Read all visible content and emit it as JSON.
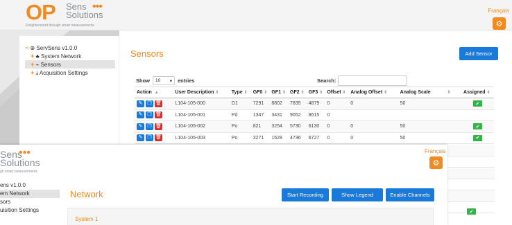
{
  "back": {
    "logo": {
      "op": "OP",
      "line1": "Sens",
      "line2": "Solutions",
      "dots": "•••",
      "tagline": "Enlightenment through smart measurements"
    },
    "language": "Français",
    "tree": {
      "root": "ServSens v1.0.0",
      "items": [
        "System Network",
        "Sensors",
        "Acquisition Settings"
      ],
      "selected_index": 1
    },
    "title": "Sensors",
    "add_button": "Add Sensor",
    "show_label": "Show",
    "show_value": "10",
    "entries_label": "entries",
    "search_label": "Search:",
    "table": {
      "headers": [
        "Action",
        "User Description",
        "Type",
        "GF0",
        "GF1",
        "GF2",
        "GF3",
        "Offset",
        "Analog Offset",
        "Analog Scale",
        "Assigned"
      ],
      "rows": [
        {
          "desc": "L104-105-000",
          "type": "D1",
          "gf0": "7291",
          "gf1": "8802",
          "gf2": "7835",
          "gf3": "4879",
          "offset": "0",
          "aoffset": "0",
          "ascale": "50",
          "assigned": true
        },
        {
          "desc": "L104-105-001",
          "type": "Pd",
          "gf0": "1347",
          "gf1": "3431",
          "gf2": "9052",
          "gf3": "8615",
          "offset": "0",
          "aoffset": "",
          "ascale": "",
          "assigned": false
        },
        {
          "desc": "L104-105-002",
          "type": "Po",
          "gf0": "821",
          "gf1": "3254",
          "gf2": "5730",
          "gf3": "6130",
          "offset": "0",
          "aoffset": "0",
          "ascale": "50",
          "assigned": true
        },
        {
          "desc": "L104-105-003",
          "type": "Po",
          "gf0": "3271",
          "gf1": "1528",
          "gf2": "4736",
          "gf3": "6727",
          "offset": "0",
          "aoffset": "0",
          "ascale": "50",
          "assigned": true
        }
      ]
    }
  },
  "front": {
    "logo": {
      "line1": "Sens",
      "line2": "Solutions",
      "dots": "•••",
      "tagline": "gh smart measurements"
    },
    "language": "Français",
    "tree": [
      "ens v1.0.0",
      "em Network",
      "sors",
      "uisition Settings"
    ],
    "selected_index": 1,
    "title": "Network",
    "buttons": {
      "start": "Start Recording",
      "legend": "Show Legend",
      "enable": "Enable Channels"
    },
    "system_title": "System 1"
  },
  "icons": {
    "gear": "⚙",
    "edit": "✎",
    "copy": "❐",
    "delete": "🗑",
    "check": "✔",
    "sort_both": "⇕",
    "sort_up": "▲",
    "caret": "▾"
  },
  "colors": {
    "accent": "#f18a21",
    "primary": "#1a7ad9",
    "danger": "#d9302f",
    "success": "#34b34b"
  }
}
